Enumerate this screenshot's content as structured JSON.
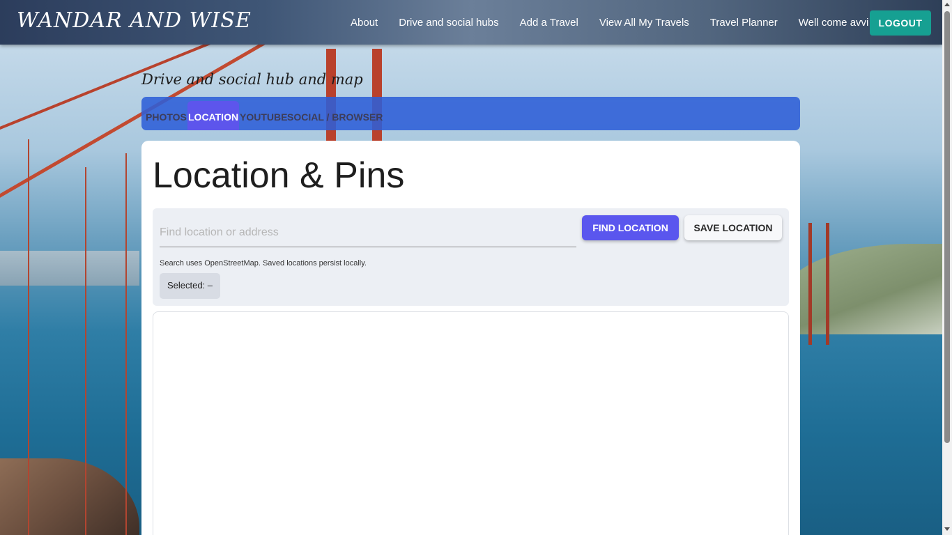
{
  "header": {
    "brand": "WANDAR AND WISE",
    "nav": [
      {
        "label": "About"
      },
      {
        "label": "Drive and social hubs"
      },
      {
        "label": "Add a Travel"
      },
      {
        "label": "View All My Travels"
      },
      {
        "label": "Travel Planner"
      },
      {
        "label": "Well come avvi"
      }
    ],
    "logout_label": "LOGOUT"
  },
  "hub": {
    "title": "Drive and social hub and map",
    "tabs": [
      {
        "label": "PHOTOS",
        "active": false
      },
      {
        "label": "LOCATION",
        "active": true
      },
      {
        "label": "YOUTUBE",
        "active": false
      },
      {
        "label": "SOCIAL / BROWSER",
        "active": false
      }
    ]
  },
  "location": {
    "title": "Location & Pins",
    "search_placeholder": "Find location or address",
    "search_value": "",
    "find_label": "FIND LOCATION",
    "save_label": "SAVE LOCATION",
    "note": "Search uses OpenStreetMap. Saved locations persist locally.",
    "selected_text": "Selected: –"
  },
  "colors": {
    "tab_bar": "#2d5fd7",
    "active_tab": "#5d55ec",
    "find_button": "#5a56ee",
    "logout_button": "#16a092"
  }
}
